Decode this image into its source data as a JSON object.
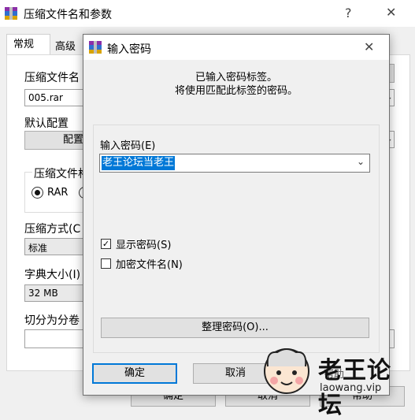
{
  "parent": {
    "title": "压缩文件名和参数",
    "help_button": "?",
    "close_button": "✕",
    "tabs": [
      "常规",
      "高级"
    ],
    "archive_name_label": "压缩文件名",
    "archive_name_value": "005.rar",
    "default_profile_label": "默认配置",
    "profile_button": "配置",
    "format_group_label": "压缩文件格",
    "format_rar": "RAR",
    "method_label": "压缩方式(C",
    "method_value": "标准",
    "dict_label": "字典大小(I)",
    "dict_value": "32 MB",
    "split_label": "切分为分卷",
    "ok_button": "确定",
    "cancel_button": "取消",
    "help_text_button": "帮助",
    "behind_button_fragment": "帮助"
  },
  "dialog": {
    "title": "输入密码",
    "close_button": "✕",
    "info_line1": "已输入密码标签。",
    "info_line2": "将使用匹配此标签的密码。",
    "password_label": "输入密码(E)",
    "password_value": "老王论坛当老王",
    "show_password_label": "显示密码(S)",
    "show_password_checked": true,
    "encrypt_names_label": "加密文件名(N)",
    "encrypt_names_checked": false,
    "organize_button": "整理密码(O)...",
    "ok_button": "确定",
    "cancel_button": "取消"
  },
  "watermark": {
    "logo": "老王论坛",
    "url": "laowang.vip"
  },
  "colors": {
    "selection": "#0078d7",
    "rar_purple": "#8b2fa8",
    "rar_blue": "#2f6fd0",
    "rar_gold": "#d8a400"
  }
}
